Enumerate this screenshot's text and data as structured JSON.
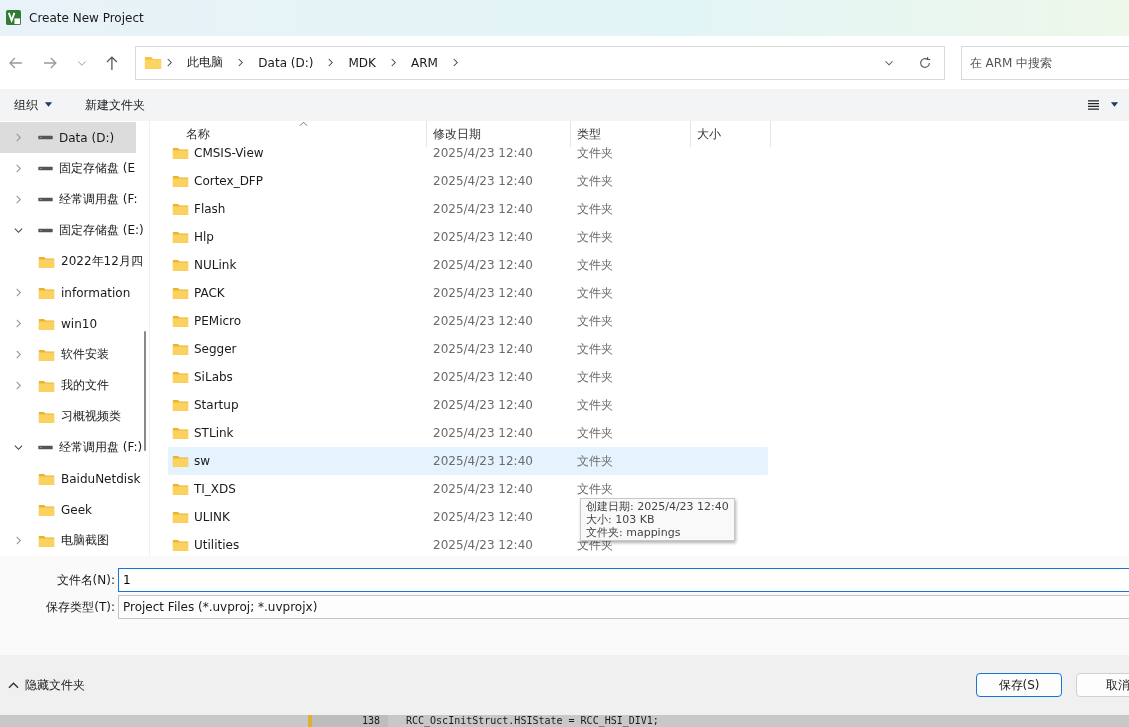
{
  "window": {
    "title": "Create New Project"
  },
  "address": {
    "segments": [
      "此电脑",
      "Data (D:)",
      "MDK",
      "ARM"
    ]
  },
  "search": {
    "placeholder": "在 ARM 中搜索"
  },
  "toolbar": {
    "organize": "组织",
    "new_folder": "新建文件夹"
  },
  "sidebar": {
    "items": [
      {
        "label": "Data (D:)",
        "kind": "drive",
        "expandable": true,
        "expanded": false,
        "selected": true
      },
      {
        "label": "固定存储盘 (E",
        "kind": "drive",
        "expandable": true,
        "expanded": false,
        "selected": false
      },
      {
        "label": "经常调用盘 (F:",
        "kind": "drive",
        "expandable": true,
        "expanded": false,
        "selected": false
      },
      {
        "label": "固定存储盘 (E:)",
        "kind": "drive",
        "expandable": true,
        "expanded": true,
        "selected": false,
        "children": [
          {
            "label": "2022年12月四",
            "kind": "folder",
            "expandable": false,
            "expanded": false,
            "selected": false
          },
          {
            "label": "information",
            "kind": "folder",
            "expandable": true,
            "expanded": false,
            "selected": false
          },
          {
            "label": "win10",
            "kind": "folder",
            "expandable": true,
            "expanded": false,
            "selected": false
          },
          {
            "label": "软件安装",
            "kind": "folder",
            "expandable": true,
            "expanded": false,
            "selected": false
          },
          {
            "label": "我的文件",
            "kind": "folder",
            "expandable": true,
            "expanded": false,
            "selected": false
          },
          {
            "label": "习概视频类",
            "kind": "folder",
            "expandable": false,
            "expanded": false,
            "selected": false
          }
        ]
      },
      {
        "label": "经常调用盘 (F:)",
        "kind": "drive",
        "expandable": true,
        "expanded": true,
        "selected": false,
        "children": [
          {
            "label": "BaiduNetdisk",
            "kind": "folder",
            "expandable": false,
            "expanded": false,
            "selected": false
          },
          {
            "label": "Geek",
            "kind": "folder",
            "expandable": false,
            "expanded": false,
            "selected": false
          },
          {
            "label": "电脑截图",
            "kind": "folder",
            "expandable": true,
            "expanded": false,
            "selected": false
          }
        ]
      }
    ]
  },
  "table": {
    "columns": [
      "名称",
      "修改日期",
      "类型",
      "大小"
    ],
    "rows": [
      {
        "name": "CMSIS-View",
        "modified": "2025/4/23 12:40",
        "type": "文件夹",
        "selected": false
      },
      {
        "name": "Cortex_DFP",
        "modified": "2025/4/23 12:40",
        "type": "文件夹",
        "selected": false
      },
      {
        "name": "Flash",
        "modified": "2025/4/23 12:40",
        "type": "文件夹",
        "selected": false
      },
      {
        "name": "Hlp",
        "modified": "2025/4/23 12:40",
        "type": "文件夹",
        "selected": false
      },
      {
        "name": "NULink",
        "modified": "2025/4/23 12:40",
        "type": "文件夹",
        "selected": false
      },
      {
        "name": "PACK",
        "modified": "2025/4/23 12:40",
        "type": "文件夹",
        "selected": false
      },
      {
        "name": "PEMicro",
        "modified": "2025/4/23 12:40",
        "type": "文件夹",
        "selected": false
      },
      {
        "name": "Segger",
        "modified": "2025/4/23 12:40",
        "type": "文件夹",
        "selected": false
      },
      {
        "name": "SiLabs",
        "modified": "2025/4/23 12:40",
        "type": "文件夹",
        "selected": false
      },
      {
        "name": "Startup",
        "modified": "2025/4/23 12:40",
        "type": "文件夹",
        "selected": false
      },
      {
        "name": "STLink",
        "modified": "2025/4/23 12:40",
        "type": "文件夹",
        "selected": false
      },
      {
        "name": "sw",
        "modified": "2025/4/23 12:40",
        "type": "文件夹",
        "selected": true
      },
      {
        "name": "TI_XDS",
        "modified": "2025/4/23 12:40",
        "type": "文件夹",
        "selected": false
      },
      {
        "name": "ULINK",
        "modified": "2025/4/23 12:40",
        "selected": false
      },
      {
        "name": "Utilities",
        "modified": "2025/4/23 12:40",
        "type": "文件夹",
        "selected": false
      }
    ]
  },
  "tooltip": {
    "lines": [
      "创建日期: 2025/4/23 12:40",
      "大小: 103 KB",
      "文件夹: mappings"
    ]
  },
  "form": {
    "filename_label": "文件名(N):",
    "filename": "1",
    "filetype_label": "保存类型(T):",
    "filetype": "Project Files (*.uvproj; *.uvprojx)"
  },
  "footer": {
    "hide_folders": "隐藏文件夹",
    "buttons": [
      {
        "label": "保存(S)",
        "default": true
      },
      {
        "label": "取消",
        "default": false
      }
    ]
  },
  "background_editor": {
    "line_number": "138",
    "code": "RCC_OscInitStruct.HSIState = RCC_HSI_DIV1;"
  }
}
